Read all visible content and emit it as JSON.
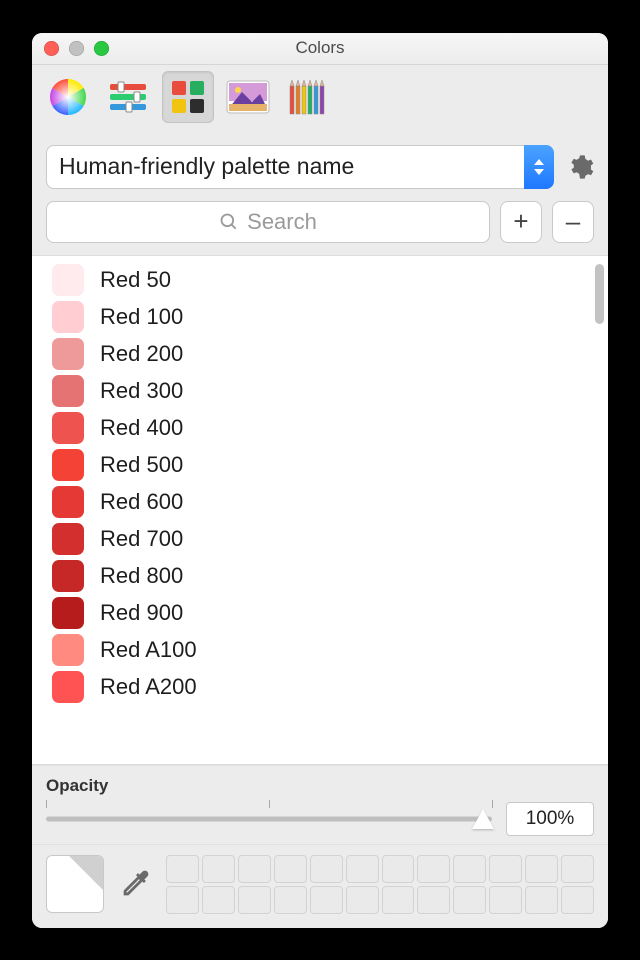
{
  "window": {
    "title": "Colors"
  },
  "modes": {
    "wheel": "color-wheel-icon",
    "sliders": "sliders-icon",
    "palettes": "palettes-icon",
    "image": "image-icon",
    "pencils": "pencils-icon",
    "selected": "palettes"
  },
  "palette_dropdown": {
    "value": "Human-friendly palette name"
  },
  "search": {
    "placeholder": "Search"
  },
  "buttons": {
    "add": "+",
    "remove": "–"
  },
  "colors": [
    {
      "name": "Red 50",
      "hex": "#FFEBEE"
    },
    {
      "name": "Red 100",
      "hex": "#FFCDD2"
    },
    {
      "name": "Red 200",
      "hex": "#EF9A9A"
    },
    {
      "name": "Red 300",
      "hex": "#E57373"
    },
    {
      "name": "Red 400",
      "hex": "#EF5350"
    },
    {
      "name": "Red 500",
      "hex": "#F44336"
    },
    {
      "name": "Red 600",
      "hex": "#E53935"
    },
    {
      "name": "Red 700",
      "hex": "#D32F2F"
    },
    {
      "name": "Red 800",
      "hex": "#C62828"
    },
    {
      "name": "Red 900",
      "hex": "#B71C1C"
    },
    {
      "name": "Red A100",
      "hex": "#FF8A80"
    },
    {
      "name": "Red A200",
      "hex": "#FF5252"
    }
  ],
  "opacity": {
    "label": "Opacity",
    "value": "100%"
  }
}
